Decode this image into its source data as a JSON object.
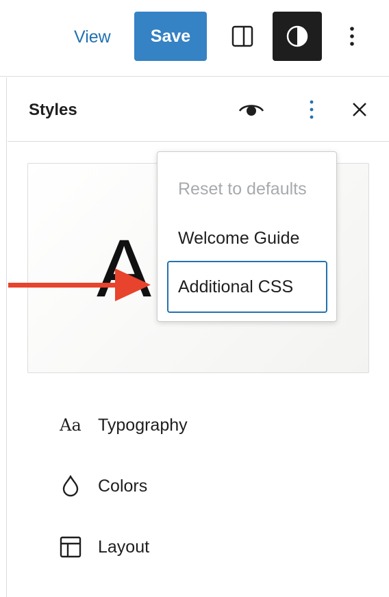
{
  "topbar": {
    "view_label": "View",
    "save_label": "Save"
  },
  "panel": {
    "title": "Styles",
    "preview_glyph": "A"
  },
  "menu": {
    "items": [
      {
        "label": "Reset to defaults",
        "state": "disabled"
      },
      {
        "label": "Welcome Guide",
        "state": "normal"
      },
      {
        "label": "Additional CSS",
        "state": "focused"
      }
    ]
  },
  "nav": {
    "typography_glyph": "Aa",
    "items": [
      {
        "label": "Typography",
        "icon": "typography-icon"
      },
      {
        "label": "Colors",
        "icon": "droplet-icon"
      },
      {
        "label": "Layout",
        "icon": "layout-icon"
      }
    ]
  },
  "colors": {
    "accent": "#2271b1",
    "save_button": "#3582c4",
    "arrow": "#e8432c",
    "dark_button": "#1e1e1e"
  }
}
